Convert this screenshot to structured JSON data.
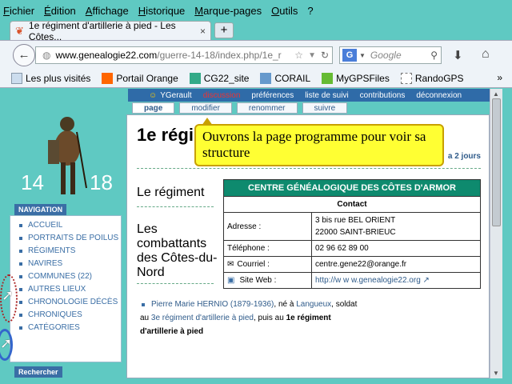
{
  "menu": [
    "Fichier",
    "Édition",
    "Affichage",
    "Historique",
    "Marque-pages",
    "Outils",
    "?"
  ],
  "tab": {
    "title": "1e régiment d'artillerie à pied - Les Côtes...",
    "close": "×",
    "new": "+"
  },
  "url": {
    "domain": "www.genealogie22.com",
    "path": "/guerre-14-18/index.php/1e_r"
  },
  "search": {
    "engine": "G",
    "placeholder": "Google"
  },
  "bookmarks": [
    "Les plus visités",
    "Portail Orange",
    "CG22_site",
    "CORAIL",
    "MyGPSFiles",
    "RandoGPS"
  ],
  "bookmarks_chevron": "»",
  "logo": {
    "left": "14",
    "right": "18"
  },
  "sidebar": {
    "nav_head": "NAVIGATION",
    "items": [
      "Accueil",
      "Portraits de poilus",
      "Régiments",
      "Navires",
      "Communes (22)",
      "Autres lieux",
      "Chronologie décès",
      "Chroniques",
      "Catégories"
    ],
    "search_head": "Rechercher"
  },
  "userbar": {
    "user": "YGerault",
    "discussion": "discussion",
    "preferences": "préférences",
    "watchlist": "liste de suivi",
    "contributions": "contributions",
    "logout": "déconnexion"
  },
  "actions": [
    "page",
    "modifier",
    "renommer",
    "suivre"
  ],
  "page": {
    "title": "1e régi",
    "two_days": "a 2 jours",
    "section1": "Le régiment",
    "section2": "Les combattants des Côtes-du-Nord"
  },
  "infobox": {
    "header": "CENTRE GÉNÉALOGIQUE DES CÔTES D'ARMOR",
    "contact": "Contact",
    "address_label": "Adresse :",
    "address_line1": "3 bis rue BEL ORIENT",
    "address_line2": "22000 SAINT-BRIEUC",
    "phone_label": "Téléphone :",
    "phone": "02 96 62 89 00",
    "email_label": "Courriel :",
    "email": "centre.gene22@orange.fr",
    "web_label": "Site Web :",
    "web": "http://w w w.genealogie22.org"
  },
  "bullet": {
    "name": "Pierre Marie HERNIO (1879-1936)",
    "born": ", né à ",
    "place": "Langueux",
    "soldier": ", soldat au ",
    "reg3": "3e régiment d'artillerie à pied",
    "then": ", puis au ",
    "reg1": "1e régiment d'artillerie à pied"
  },
  "callout": "Ouvrons la page programme pour voir sa structure"
}
